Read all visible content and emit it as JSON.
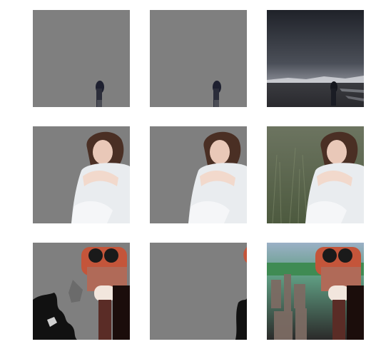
{
  "figure": {
    "rows": [
      {
        "subject": "person-standing-on-beach",
        "panels": [
          "mask-a",
          "mask-b",
          "original"
        ]
      },
      {
        "subject": "woman-sitting-in-grass",
        "panels": [
          "mask-a",
          "mask-b",
          "original"
        ]
      },
      {
        "subject": "tower-viewer-binoculars",
        "panels": [
          "mask-a",
          "mask-b",
          "original"
        ]
      }
    ],
    "colors": {
      "mask_gray": "#7f7f7f",
      "sky_dark": "#26282f",
      "grass": "#5f6a4f",
      "viewer_orange": "#c4553a"
    }
  }
}
